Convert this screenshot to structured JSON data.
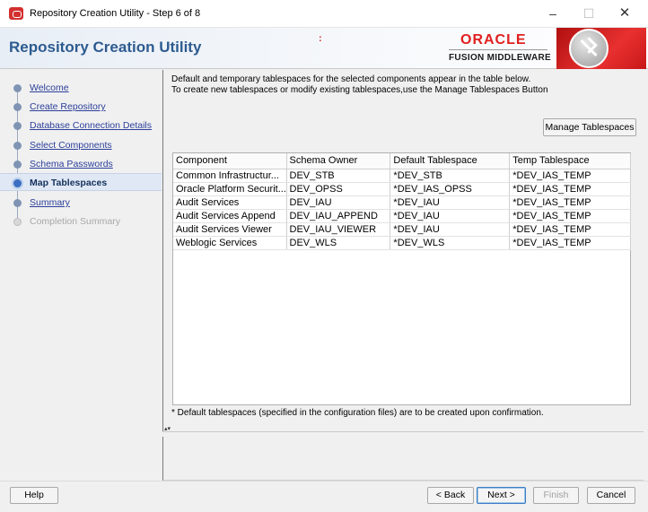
{
  "window": {
    "title": "Repository Creation Utility - Step 6 of 8",
    "minimize": "–",
    "maximize": "☐",
    "close": "✕"
  },
  "header": {
    "title": "Repository Creation Utility",
    "dot": ":",
    "oracle": "ORACLE",
    "product": "FUSION MIDDLEWARE"
  },
  "nav": {
    "items": [
      {
        "label": "Welcome",
        "state": "done"
      },
      {
        "label": "Create Repository",
        "state": "done"
      },
      {
        "label": "Database Connection Details",
        "state": "done"
      },
      {
        "label": "Select Components",
        "state": "done"
      },
      {
        "label": "Schema Passwords",
        "state": "done"
      },
      {
        "label": "Map Tablespaces",
        "state": "current"
      },
      {
        "label": "Summary",
        "state": "done"
      },
      {
        "label": "Completion Summary",
        "state": "disabled"
      }
    ]
  },
  "main": {
    "description_line1": "Default and temporary tablespaces for the selected components appear in the table below.",
    "description_line2": "To create new tablespaces or modify existing tablespaces,use the Manage Tablespaces Button",
    "manage_button": "Manage Tablespaces",
    "table": {
      "headers": [
        "Component",
        "Schema Owner",
        "Default Tablespace",
        "Temp Tablespace"
      ],
      "rows": [
        [
          "Common Infrastructur...",
          "DEV_STB",
          "*DEV_STB",
          "*DEV_IAS_TEMP"
        ],
        [
          "Oracle Platform Securit...",
          "DEV_OPSS",
          "*DEV_IAS_OPSS",
          "*DEV_IAS_TEMP"
        ],
        [
          "Audit Services",
          "DEV_IAU",
          "*DEV_IAU",
          "*DEV_IAS_TEMP"
        ],
        [
          "Audit Services Append",
          "DEV_IAU_APPEND",
          "*DEV_IAU",
          "*DEV_IAS_TEMP"
        ],
        [
          "Audit Services Viewer",
          "DEV_IAU_VIEWER",
          "*DEV_IAU",
          "*DEV_IAS_TEMP"
        ],
        [
          "Weblogic Services",
          "DEV_WLS",
          "*DEV_WLS",
          "*DEV_IAS_TEMP"
        ]
      ]
    },
    "footnote": "* Default tablespaces (specified in the configuration files) are to be created upon confirmation.",
    "splitter_arrows": "▴▾"
  },
  "buttons": {
    "help": "Help",
    "back": "< Back",
    "next": "Next >",
    "finish": "Finish",
    "cancel": "Cancel"
  }
}
